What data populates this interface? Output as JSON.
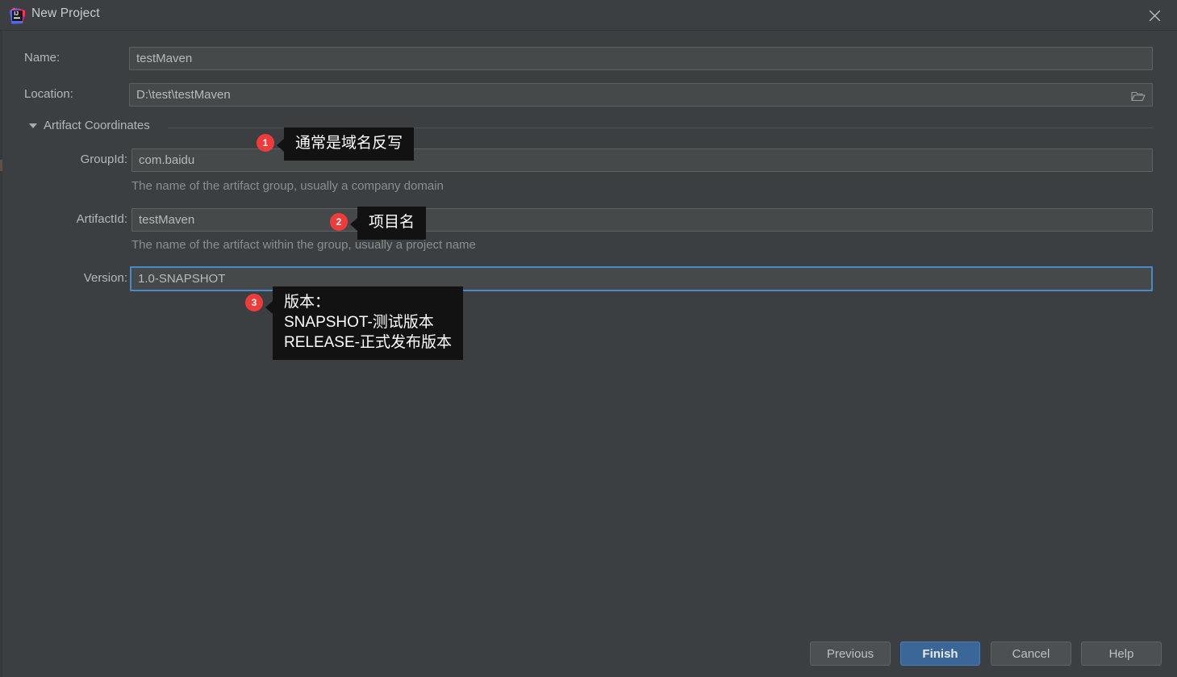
{
  "window": {
    "title": "New Project",
    "app_icon": "intellij-idea-icon",
    "close_icon": "close-icon"
  },
  "form": {
    "name": {
      "label": "Name:",
      "value": "testMaven"
    },
    "location": {
      "label": "Location:",
      "value": "D:\\test\\testMaven",
      "browse_icon": "folder-icon"
    },
    "section": {
      "title": "Artifact Coordinates",
      "arrow_icon": "chevron-down-icon"
    },
    "group_id": {
      "label": "GroupId:",
      "value": "com.baidu",
      "helper": "The name of the artifact group, usually a company domain"
    },
    "artifact_id": {
      "label": "ArtifactId:",
      "value": "testMaven",
      "helper": "The name of the artifact within the group, usually a project name"
    },
    "version": {
      "label": "Version:",
      "value": "1.0-SNAPSHOT",
      "focused": true
    }
  },
  "annotations": [
    {
      "number": "1",
      "text": "通常是域名反写"
    },
    {
      "number": "2",
      "text": "项目名"
    },
    {
      "number": "3",
      "text": "版本：\nSNAPSHOT-测试版本\nRELEASE-正式发布版本"
    }
  ],
  "buttons": {
    "previous": "Previous",
    "finish": "Finish",
    "cancel": "Cancel",
    "help": "Help"
  },
  "colors": {
    "dialog_background": "#3c3f41",
    "field_background": "#45494a",
    "accent_blue": "#3b6698",
    "focus_border": "#4a88c7",
    "badge_red": "#f03b3b",
    "callout_background": "#121212"
  }
}
